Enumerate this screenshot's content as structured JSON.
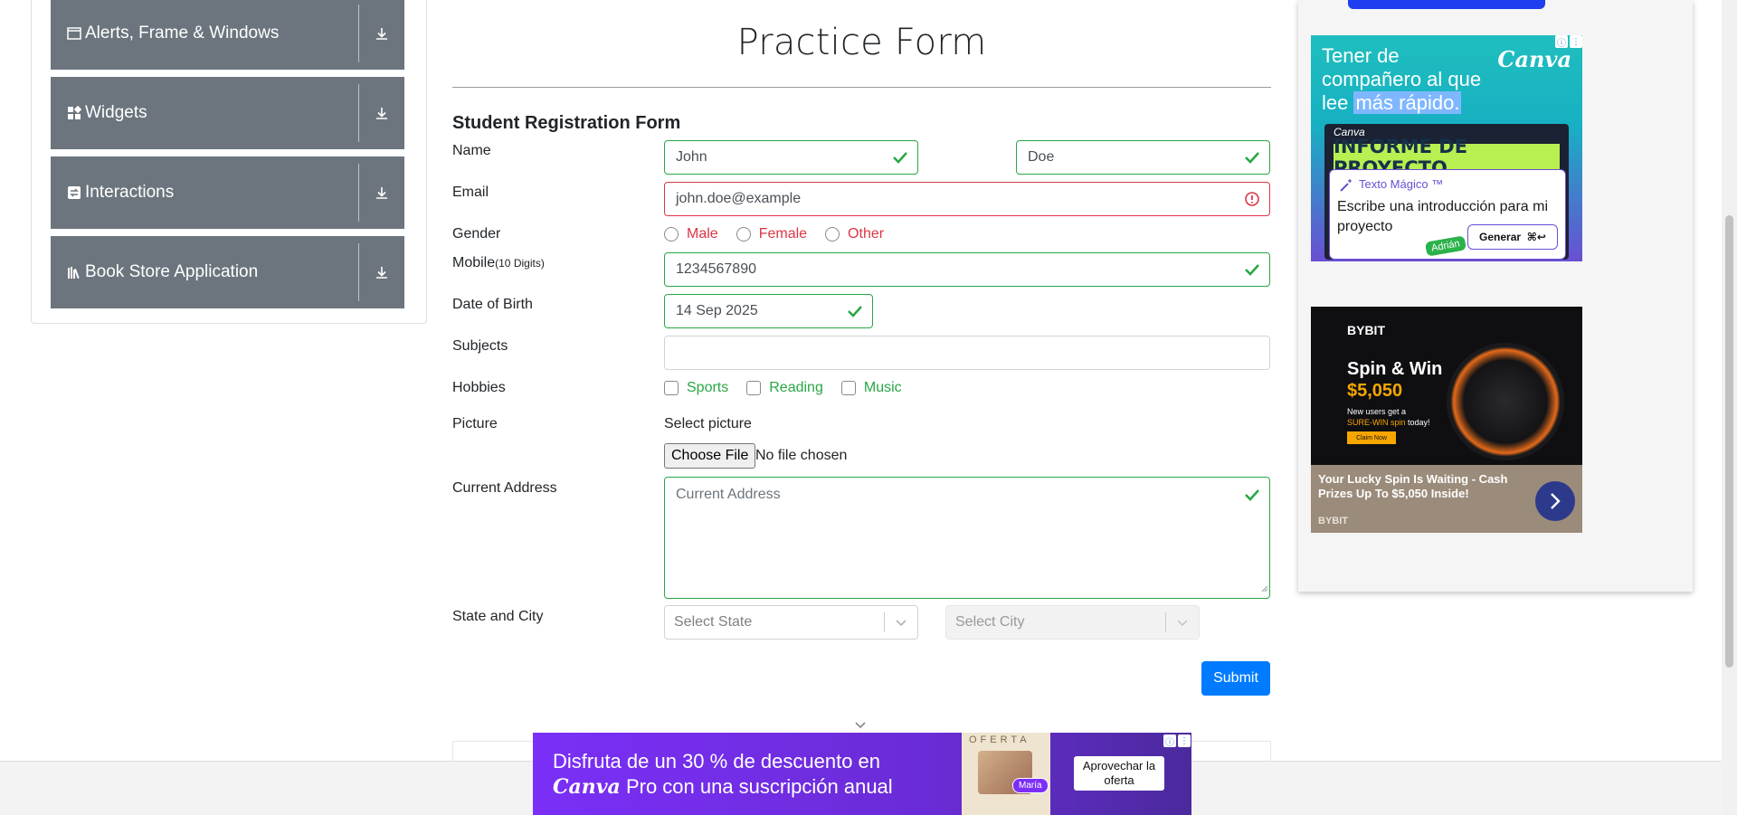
{
  "sidebar": {
    "groups": [
      {
        "label": "Alerts, Frame & Windows",
        "icon": "window-icon"
      },
      {
        "label": "Widgets",
        "icon": "widgets-icon"
      },
      {
        "label": "Interactions",
        "icon": "interactions-icon"
      },
      {
        "label": "Book Store Application",
        "icon": "books-icon"
      }
    ]
  },
  "form": {
    "page_title": "Practice Form",
    "subtitle": "Student Registration Form",
    "labels": {
      "name": "Name",
      "email": "Email",
      "gender": "Gender",
      "mobile": "Mobile",
      "mobile_hint": "(10 Digits)",
      "dob": "Date of Birth",
      "subjects": "Subjects",
      "hobbies": "Hobbies",
      "picture": "Picture",
      "address": "Current Address",
      "state_city": "State and City"
    },
    "first_name": "John",
    "last_name": "Doe",
    "email": "john.doe@example",
    "gender_options": [
      "Male",
      "Female",
      "Other"
    ],
    "mobile": "1234567890",
    "dob": "14 Sep 2025",
    "subjects": "",
    "hobby_options": [
      "Sports",
      "Reading",
      "Music"
    ],
    "picture_label": "Select picture",
    "file_button": "Choose File",
    "file_status": "No file chosen",
    "address_placeholder": "Current Address",
    "state_placeholder": "Select State",
    "city_placeholder": "Select City",
    "submit": "Submit",
    "colors": {
      "valid": "#28a745",
      "invalid": "#dc3545",
      "primary": "#007bff",
      "sidebar": "#6c757d"
    }
  },
  "ads": {
    "canva": {
      "headline_1": "Tener de compañero al que lee",
      "headline_highlight": "más rápido.",
      "brand": "Canva",
      "poster_brand": "Canva",
      "poster_title": "INFORME DE PROYECTO",
      "popup_title": "Texto Mágico ™",
      "popup_text": "Escribe una introducción para mi proyecto",
      "generate": "Generar",
      "shortcut": "⌘↩",
      "tag": "Adrián"
    },
    "bybit": {
      "logo": "BYBIT",
      "headline": "Spin & Win",
      "amount": "$5,050",
      "small_1": "New users get a",
      "small_highlight": "SURE-WIN spin",
      "small_2": "today!",
      "claim": "Claim Now",
      "caption": "Your Lucky Spin Is Waiting - Cash Prizes Up To $5,050 Inside!",
      "brand": "BYBIT"
    },
    "banner": {
      "text_1": "Disfruta de un 30 % de descuento en",
      "canva": "Canva",
      "text_2": "Pro con una suscripción anual",
      "oferta": "OFERTA",
      "person": "María",
      "cta": "Aprovechar la oferta"
    }
  }
}
